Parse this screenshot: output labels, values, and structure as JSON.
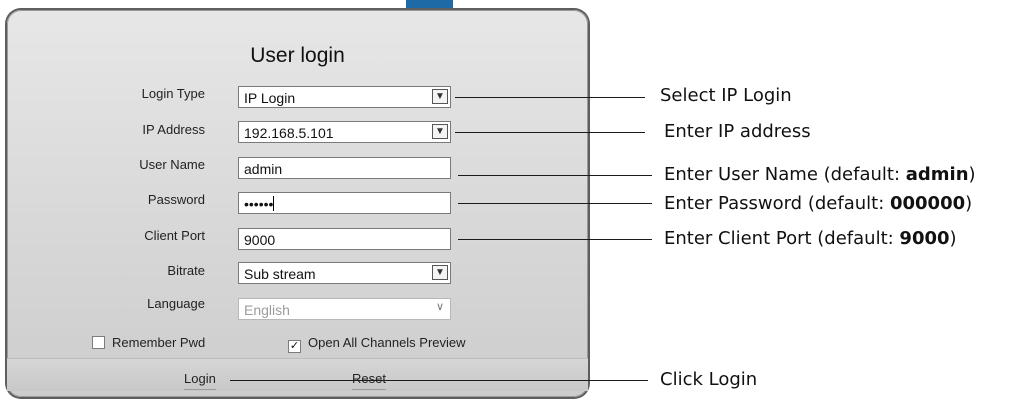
{
  "dialog": {
    "title": "User login",
    "fields": {
      "login_type": {
        "label": "Login Type",
        "value": "IP Login"
      },
      "ip_address": {
        "label": "IP Address",
        "value": "192.168.5.101"
      },
      "user_name": {
        "label": "User Name",
        "value": "admin"
      },
      "password": {
        "label": "Password",
        "value": "••••••"
      },
      "client_port": {
        "label": "Client Port",
        "value": "9000"
      },
      "bitrate": {
        "label": "Bitrate",
        "value": "Sub stream"
      },
      "language": {
        "label": "Language",
        "value": "English"
      }
    },
    "remember_pwd": {
      "label": "Remember Pwd",
      "checked": false
    },
    "open_all_channels": {
      "label": "Open All Channels Preview",
      "checked": true,
      "mark": "✓"
    },
    "login_button": "Login",
    "reset_button": "Reset"
  },
  "annotations": {
    "login_type": {
      "text": "Select IP Login"
    },
    "ip_address": {
      "text": "Enter IP address"
    },
    "user_name": {
      "prefix": "Enter User Name (default: ",
      "value": "admin",
      "suffix": ")"
    },
    "password": {
      "prefix": "Enter Password (default: ",
      "value": "000000",
      "suffix": ")"
    },
    "client_port": {
      "prefix": "Enter Client Port (default: ",
      "value": "9000",
      "suffix": ")"
    },
    "login": {
      "text": "Click Login"
    }
  }
}
